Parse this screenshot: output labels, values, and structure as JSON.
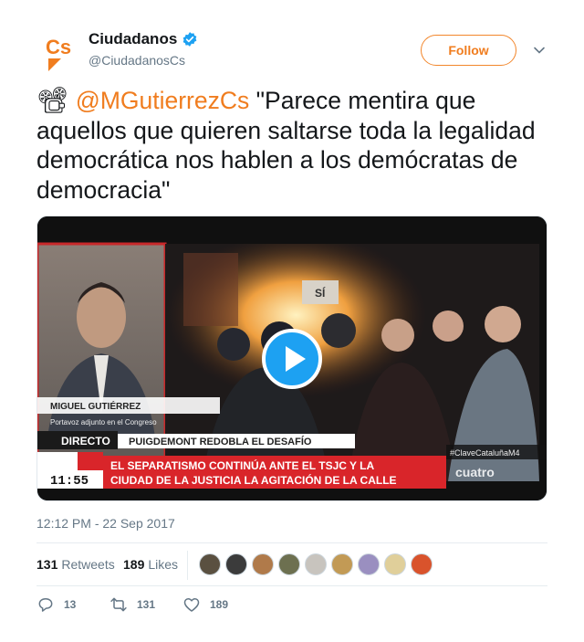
{
  "account": {
    "display_name": "Ciudadanos",
    "handle": "@CiudadanosCs",
    "avatar_icon": "ciudadanos-cs-logo",
    "avatar_text": "Cs",
    "verified": true
  },
  "follow_label": "Follow",
  "tweet": {
    "emoji": "📽",
    "mention": "@MGutierrezCs",
    "text": " \"Parece mentira que aquellos que quieren saltarse toda la legalidad democrática nos hablen a los demócratas de democracia\""
  },
  "video": {
    "overlay": {
      "speaker_name": "MIGUEL GUTIÉRREZ",
      "speaker_role": "Portavoz adjunto en el Congreso",
      "directo": "DIRECTO",
      "headline": "PUIGDEMONT REDOBLA EL DESAFÍO",
      "ticker_line1": "EL SEPARATISMO CONTINÚA ANTE EL TSJC Y LA",
      "ticker_line2": "CIUDAD DE LA JUSTICIA LA AGITACIÓN DE LA CALLE",
      "hashtag": "#ClaveCataluñaM4",
      "clock": "11:55",
      "channel": "cuatro",
      "sign_text": "SÍ"
    }
  },
  "timestamp": "12:12 PM - 22 Sep 2017",
  "stats": {
    "retweets_count": "131",
    "retweets_label": "Retweets",
    "likes_count": "189",
    "likes_label": "Likes"
  },
  "likers": [
    "#5a5040",
    "#3b3b3b",
    "#b07a4a",
    "#6d7050",
    "#c8c4be",
    "#c29a55",
    "#9a8fc0",
    "#e0cf9a",
    "#d9532c"
  ],
  "actions": {
    "replies": "13",
    "retweets": "131",
    "likes": "189"
  },
  "colors": {
    "brand_orange": "#f07d1f",
    "verified_blue": "#1da1f2",
    "secondary_text": "#657786"
  }
}
